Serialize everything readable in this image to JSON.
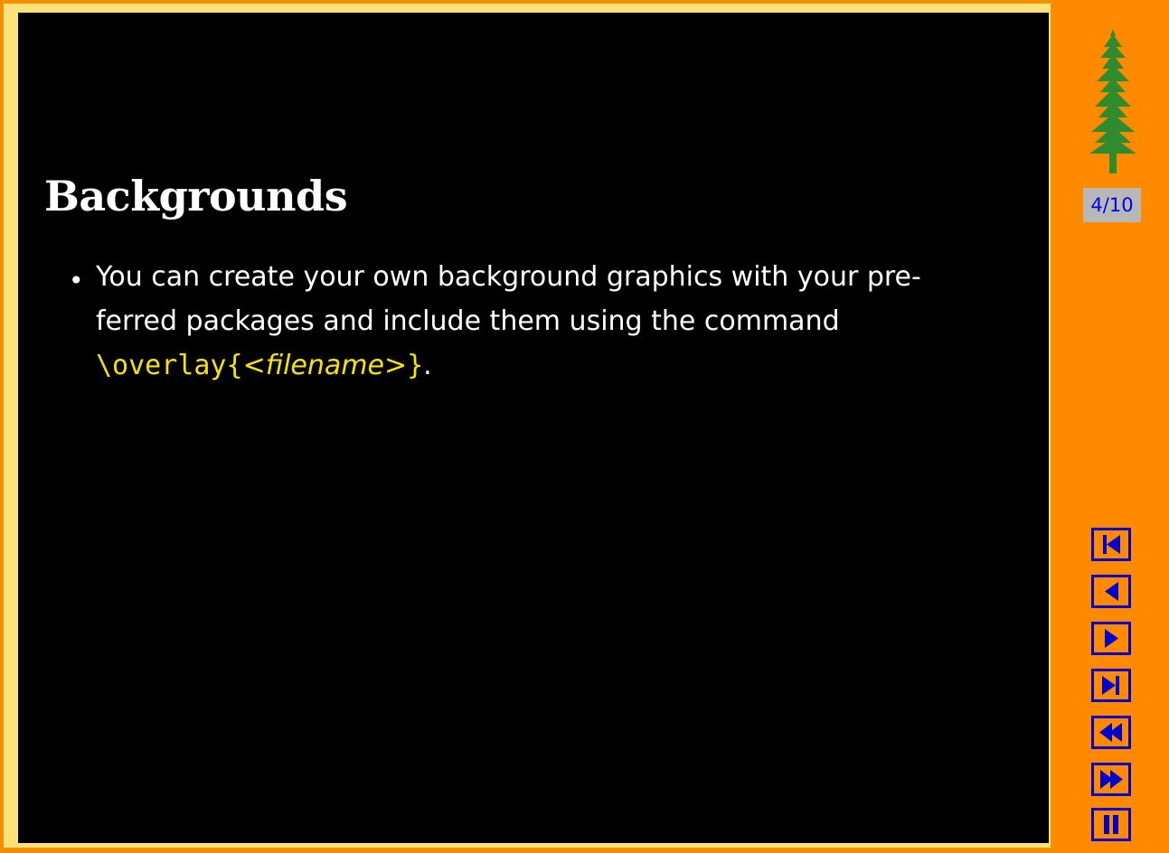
{
  "slide": {
    "title": "Backgrounds",
    "bullet": {
      "marker": "•",
      "line1": "You can create your own background graphics with your pre-",
      "line2": "ferred packages and include them using the command",
      "command_prefix": "\\overlay{",
      "arg_open": "<",
      "arg_name": "filename",
      "arg_close": ">",
      "command_suffix": "}",
      "trailing": "."
    }
  },
  "sidebar": {
    "logo_icon": "redwood-tree-icon",
    "page_counter": "4/10",
    "nav": [
      {
        "name": "first-page",
        "icon": "skip-first-icon"
      },
      {
        "name": "previous-page",
        "icon": "previous-icon"
      },
      {
        "name": "next-page",
        "icon": "next-icon"
      },
      {
        "name": "last-page",
        "icon": "skip-last-icon"
      },
      {
        "name": "go-back",
        "icon": "rewind-icon"
      },
      {
        "name": "go-forward",
        "icon": "fast-forward-icon"
      },
      {
        "name": "pause",
        "icon": "pause-icon"
      }
    ]
  },
  "colors": {
    "background": "#000000",
    "frame": "#ffe27a",
    "sidebar": "#ff8a00",
    "code": "#f4e400",
    "nav_icon": "#0000cc",
    "tree": "#2e8b2e"
  }
}
